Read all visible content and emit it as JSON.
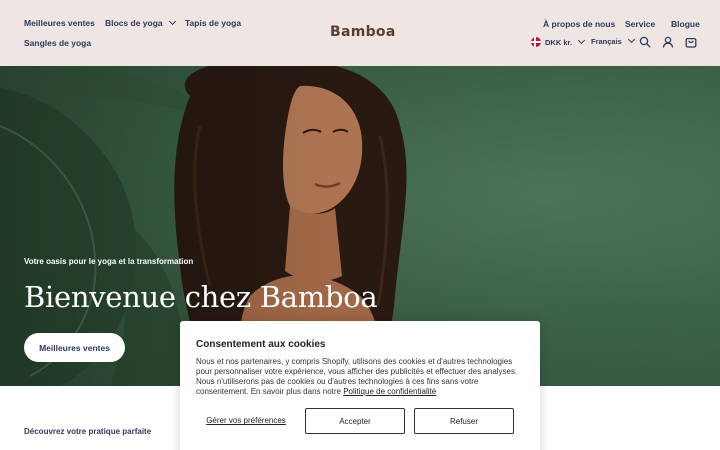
{
  "header": {
    "brand": "Bamboa",
    "nav_left": {
      "best_sellers": "Meilleures ventes",
      "yoga_blocks": "Blocs de yoga",
      "yoga_mats": "Tapis de yoga",
      "yoga_straps": "Sangles de yoga"
    },
    "nav_right": {
      "about": "À propos de nous",
      "service": "Service",
      "blog": "Blogue"
    },
    "currency": "DKK kr.",
    "language": "Français",
    "icons": [
      "search-icon",
      "account-icon",
      "cart-icon",
      "denmark-flag-icon",
      "chevron-down-icon"
    ]
  },
  "hero": {
    "subtitle": "Votre oasis pour le yoga et la transformation",
    "title": "Bienvenue chez Bamboa",
    "cta": "Meilleures ventes"
  },
  "section": {
    "heading": "Découvrez votre pratique parfaite"
  },
  "cookie": {
    "title": "Consentement aux cookies",
    "text": "Nous et nos partenaires, y compris Shopify, utilisons des cookies et d'autres technologies pour personnaliser votre expérience, vous afficher des publicités et effectuer des analyses. Nous n'utiliserons pas de cookies ou d'autres technologies à ces fins sans votre consentement. En savoir plus dans notre",
    "privacy_link": "Politique de confidentialité",
    "manage": "Gérer vos préférences",
    "accept": "Accepter",
    "decline": "Refuser"
  },
  "colors": {
    "header_bg": "#efe5e3",
    "nav_text": "#2c3a5c",
    "logo": "#5b3d2e",
    "hero_green": "#3d6448"
  }
}
